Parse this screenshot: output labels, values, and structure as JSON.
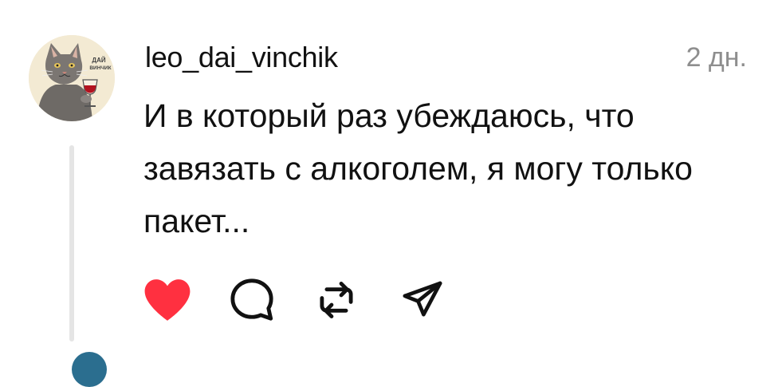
{
  "post": {
    "username": "leo_dai_vinchik",
    "timestamp": "2 дн.",
    "text_lines": [
      "И в который раз убеждаюсь, что",
      "завязать с алкоголем, я могу только",
      "пакет..."
    ],
    "avatar": {
      "icon": "cat-with-wine-glass",
      "caption_line1": "ДАЙ",
      "caption_line2": "ВИНЧИК"
    }
  },
  "actions": {
    "like": {
      "icon": "heart-icon",
      "liked": true,
      "color": "#ff3040"
    },
    "comment": {
      "icon": "comment-icon"
    },
    "repost": {
      "icon": "repost-icon"
    },
    "share": {
      "icon": "send-icon"
    }
  },
  "colors": {
    "text": "#111111",
    "secondary": "#8e8e8e",
    "thread_line": "#e5e5e5",
    "like": "#ff3040"
  }
}
